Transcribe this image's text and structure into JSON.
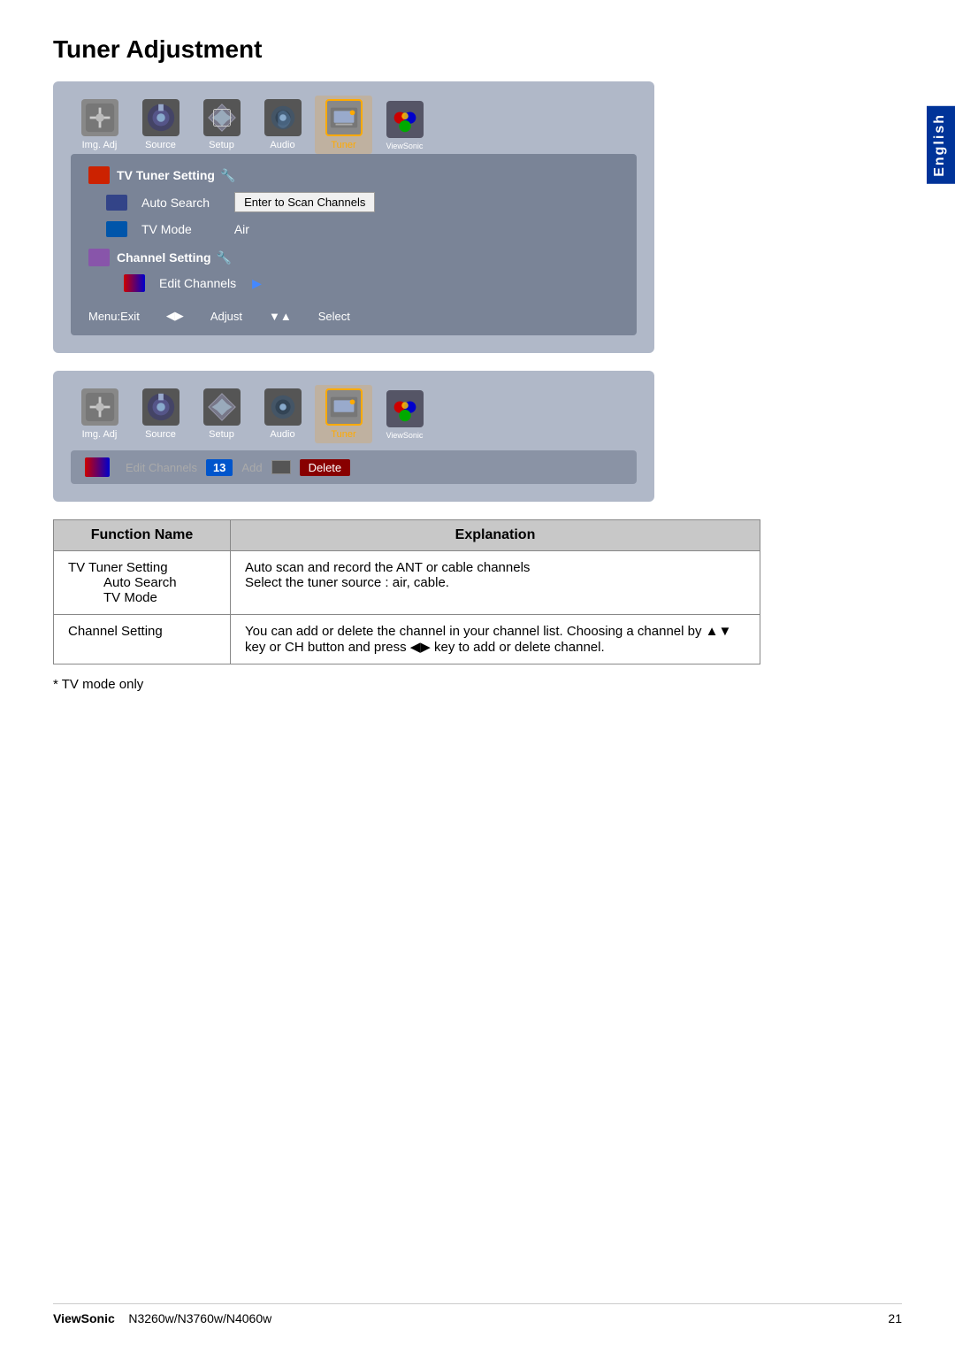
{
  "page": {
    "title": "Tuner Adjustment",
    "english_tab": "English",
    "footnote": "* TV mode only",
    "footer": {
      "brand": "ViewSonic",
      "model": "N3260w/N3760w/N4060w",
      "page_number": "21"
    }
  },
  "menu_bar_1": {
    "items": [
      {
        "id": "img-adj",
        "label": "Img. Adj",
        "active": false
      },
      {
        "id": "source",
        "label": "Source",
        "active": false
      },
      {
        "id": "setup",
        "label": "Setup",
        "active": false
      },
      {
        "id": "audio",
        "label": "Audio",
        "active": false
      },
      {
        "id": "tuner",
        "label": "Tuner",
        "active": true
      },
      {
        "id": "viewsonic",
        "label": "ViewSonic",
        "active": false
      }
    ]
  },
  "submenu": {
    "section1_title": "TV Tuner Setting",
    "row1_label": "Auto Search",
    "row1_button": "Enter to Scan Channels",
    "row2_label": "TV Mode",
    "row2_value": "Air",
    "section2_title": "Channel Setting",
    "row3_label": "Edit Channels",
    "toolbar": {
      "menu_exit": "Menu:Exit",
      "adjust": "Adjust",
      "select": "Select"
    }
  },
  "edit_bar": {
    "icon_label": "Edit Channels",
    "number": "13",
    "add_label": "Add",
    "delete_label": "Delete"
  },
  "function_table": {
    "col1_header": "Function Name",
    "col2_header": "Explanation",
    "rows": [
      {
        "name": "TV Tuner Setting",
        "sub": [
          {
            "label": "Auto Search",
            "explanation": "Auto scan and record the ANT or cable channels"
          },
          {
            "label": "TV Mode",
            "explanation": "Select the tuner source : air, cable."
          }
        ],
        "explanation": ""
      },
      {
        "name": "Channel Setting",
        "explanation": "You can add or delete the channel in your channel list. Choosing a channel by ▲▼ key or CH button and press ◀▶ key to add or delete channel."
      }
    ]
  },
  "page_number": "21"
}
